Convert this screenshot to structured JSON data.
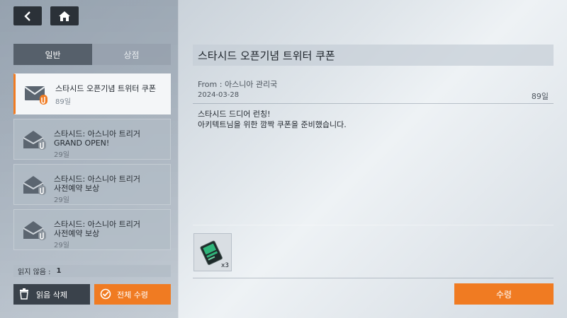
{
  "nav": {
    "back_icon": "back-arrow-icon",
    "home_icon": "home-icon"
  },
  "tabs": [
    {
      "label": "일반",
      "active": true
    },
    {
      "label": "상점",
      "active": false
    }
  ],
  "mail_list": [
    {
      "title": "스타시드 오픈기념 트위터 쿠폰",
      "days": "89일",
      "selected": true
    },
    {
      "title": "스타시드: 아스니아 트리거\nGRAND OPEN!",
      "days": "29일",
      "selected": false
    },
    {
      "title": "스타시드: 아스니아 트리거\n사전예약 보상",
      "days": "29일",
      "selected": false
    },
    {
      "title": "스타시드: 아스니아 트리거\n사전예약 보상",
      "days": "29일",
      "selected": false
    }
  ],
  "unread": {
    "label": "읽지 않음 :",
    "count": "1"
  },
  "buttons": {
    "delete_read": "읽음 삭제",
    "receive_all": "전체 수령",
    "receive": "수령"
  },
  "detail": {
    "title": "스타시드 오픈기념 트위터 쿠폰",
    "from": "From : 아스니아 관리국",
    "date": "2024-03-28",
    "days": "89일",
    "body": "스타시드 드디어 런칭!\n아키텍트님을 위한 깜짝 쿠폰을 준비했습니다."
  },
  "reward": {
    "qty": "x3",
    "icon": "coupon-card-icon"
  },
  "colors": {
    "accent": "#f07b22",
    "dark_button": "#2b3138"
  }
}
